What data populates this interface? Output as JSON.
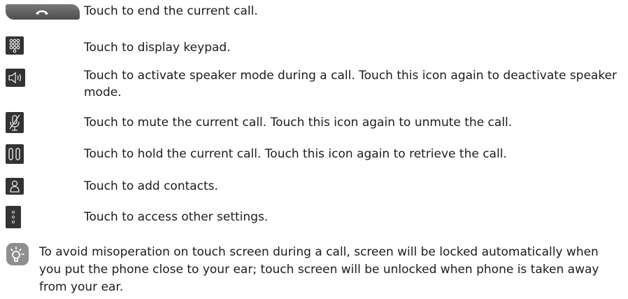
{
  "items": [
    {
      "icon": "end-call-icon",
      "text": "Touch to end the current call."
    },
    {
      "icon": "keypad-icon",
      "text": "Touch to display keypad."
    },
    {
      "icon": "speaker-icon",
      "text": "Touch to activate speaker mode during a call. Touch this icon again to deactivate speaker mode."
    },
    {
      "icon": "mute-icon",
      "text": "Touch to mute the current call. Touch this icon again to unmute the call."
    },
    {
      "icon": "hold-icon",
      "text": "Touch to hold the current call. Touch this icon again to retrieve the call."
    },
    {
      "icon": "add-contact-icon",
      "text": "Touch to add contacts."
    },
    {
      "icon": "more-settings-icon",
      "text": "Touch to access other settings."
    }
  ],
  "note": {
    "icon": "tip-lightbulb-icon",
    "text": "To avoid misoperation on touch screen during a call, screen will be locked automatically when you put the phone close to your ear; touch screen will be unlocked when phone is taken away from your ear."
  }
}
